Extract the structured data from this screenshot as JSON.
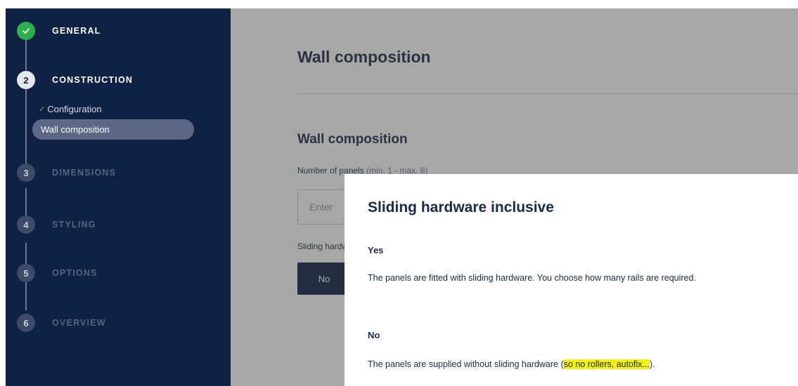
{
  "sidebar": {
    "steps": [
      {
        "number": "",
        "label": "GENERAL",
        "state": "done",
        "icon": "check-icon"
      },
      {
        "number": "2",
        "label": "CONSTRUCTION",
        "state": "active"
      },
      {
        "number": "3",
        "label": "DIMENSIONS",
        "state": "inactive"
      },
      {
        "number": "4",
        "label": "STYLING",
        "state": "inactive"
      },
      {
        "number": "5",
        "label": "OPTIONS",
        "state": "inactive"
      },
      {
        "number": "6",
        "label": "OVERVIEW",
        "state": "inactive"
      }
    ],
    "substeps": [
      {
        "label": "Configuration",
        "state": "done",
        "check": "✓"
      },
      {
        "label": "Wall composition",
        "state": "active"
      }
    ]
  },
  "main": {
    "page_title": "Wall composition",
    "section_title": "Wall composition",
    "panels_label": "Number of panels",
    "panels_hint": "(min. 1 - max. 8)",
    "panels_placeholder": "Enter",
    "sliding_label": "Sliding hardware inclusive",
    "no_button": "No"
  },
  "modal": {
    "title": "Sliding hardware inclusive",
    "options": [
      {
        "title": "Yes",
        "description": "The panels are fitted with sliding hardware. You choose how many rails are required."
      },
      {
        "title": "No",
        "description_before": "The panels are supplied without sliding hardware (",
        "description_highlight": "so no rollers, autofix...",
        "description_after": ")."
      }
    ]
  },
  "colors": {
    "sidebar_bg": "#0f2144",
    "done_green": "#2bb24c",
    "active_pill": "#5c6886",
    "primary_button": "#0f2144",
    "highlight": "#f5f20b"
  }
}
